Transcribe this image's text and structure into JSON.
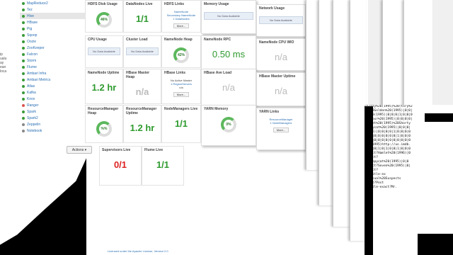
{
  "sidebar": {
    "items": [
      {
        "label": "MapReduce2",
        "status": "green"
      },
      {
        "label": "Tez",
        "status": "green"
      },
      {
        "label": "Hive",
        "status": "green",
        "selected": true
      },
      {
        "label": "HBase",
        "status": "green"
      },
      {
        "label": "Pig",
        "status": "green"
      },
      {
        "label": "Sqoop",
        "status": "green"
      },
      {
        "label": "Oozie",
        "status": "green"
      },
      {
        "label": "ZooKeeper",
        "status": "green"
      },
      {
        "label": "Falcon",
        "status": "green"
      },
      {
        "label": "Storm",
        "status": "green"
      },
      {
        "label": "Flume",
        "status": "green"
      },
      {
        "label": "Ambari Infra",
        "status": "green"
      },
      {
        "label": "Ambari Metrics",
        "status": "green"
      },
      {
        "label": "Atlas",
        "status": "green"
      },
      {
        "label": "Kafka",
        "status": "green"
      },
      {
        "label": "Knox",
        "status": "green"
      },
      {
        "label": "Ranger",
        "status": "red"
      },
      {
        "label": "Spark",
        "status": "green"
      },
      {
        "label": "Spark2",
        "status": "green"
      },
      {
        "label": "Zeppelin",
        "status": "gray"
      },
      {
        "label": "Notebook",
        "status": "gray"
      }
    ],
    "actions_label": "Actions ▾"
  },
  "left_fragments": [
    "ip",
    "ualu",
    "ay",
    "ean",
    "loca"
  ],
  "widgets": {
    "hdfs_disk": {
      "title": "HDFS Disk Usage",
      "percent": "46%"
    },
    "datanodes": {
      "title": "DataNodes Live",
      "value": "1/1"
    },
    "hdfs_links": {
      "title": "HDFS Links",
      "links": [
        "NameNode",
        "Secondary NameNode",
        "1 DataNodes"
      ],
      "more": "More..."
    },
    "cpu": {
      "title": "CPU Usage",
      "na": "No Data Available"
    },
    "cluster_load": {
      "title": "Cluster Load",
      "na": "No Data Available"
    },
    "nn_heap": {
      "title": "NameNode Heap",
      "percent": "42%"
    },
    "nn_uptime": {
      "title": "NameNode Uptime",
      "value": "1.2 hr"
    },
    "hbase_heap": {
      "title": "HBase Master Heap",
      "value": "n/a"
    },
    "hbase_links": {
      "title": "HBase Links",
      "lines": [
        "No Active Master",
        "1 RegionServers",
        "n/a"
      ],
      "more": "More..."
    },
    "rm_heap": {
      "title": "ResourceManager Heap",
      "percent": "%%"
    },
    "rm_uptime": {
      "title": "ResourceManager Uptime",
      "value": "1.2 hr"
    },
    "nm_live": {
      "title": "NodeManagers Live",
      "value": "1/1"
    },
    "supervisors": {
      "title": "Supervisors Live",
      "value": "0/1"
    },
    "flume": {
      "title": "Flume Live",
      "value": "1/1"
    }
  },
  "ghost_widgets": {
    "memory": {
      "title": "Memory Usage",
      "na": "No Data Available"
    },
    "network": {
      "title": "Network Usage",
      "na": "No Data Available"
    },
    "rpc": {
      "title": "NameNode RPC",
      "value": "0.50 ms"
    },
    "cpu_wio": {
      "title": "NameNode CPU WIO",
      "value": "n/a"
    },
    "regionserver": {
      "title": "HBase Ave Load",
      "value": "n/a"
    },
    "hbase_uptime": {
      "title": "HBase Master Uptime",
      "value": "n/a"
    },
    "yarn_memory": {
      "title": "YARN Memory",
      "percent": "0%"
    },
    "yarn_links": {
      "title": "YARN Links",
      "links": [
        "ResourceManager",
        "1 NodeManagers"
      ],
      "more": "More..."
    }
  },
  "terminal_lines": [
    "ct?tty%20(1995)%20(tory%2",
    "20%28Golden%20(1995)|0|0|",
    "ye%20(1995)|0|0|0|1|0|0|0",
    "ct?Four%20(1995)|0|0|0|0|",
    "ct?Get%20(1995)%20Shorty",
    "?Copycat%20(1995)|0|0|0|",
    "(1995)|0|0|0|0|1|0|0|0|0",
    "|0|0|0|0|0|0|0|0|1|0|0|0",
    "|0|0|0|0|0|0|0|0|0|0|0|0",
    "ct?(1995)http://us.imdb.",
    "|0|0|0|1|0|1|0|0|1|0|0|0",
    "-exact?Hamlet%20(1996)|0",
    "-exact?",
    "ct?Copycat%20(1995)|0|0",
    "-exact?Seven%20(1995)|0|",
    "-exact?",
    "ct?Title-ex",
    "ct?Usual%20Suspects",
    "exact?Post",
    "ct?itle-exact?Mr."
  ],
  "footer": "Licensed under the Apache License, Version 2.0"
}
